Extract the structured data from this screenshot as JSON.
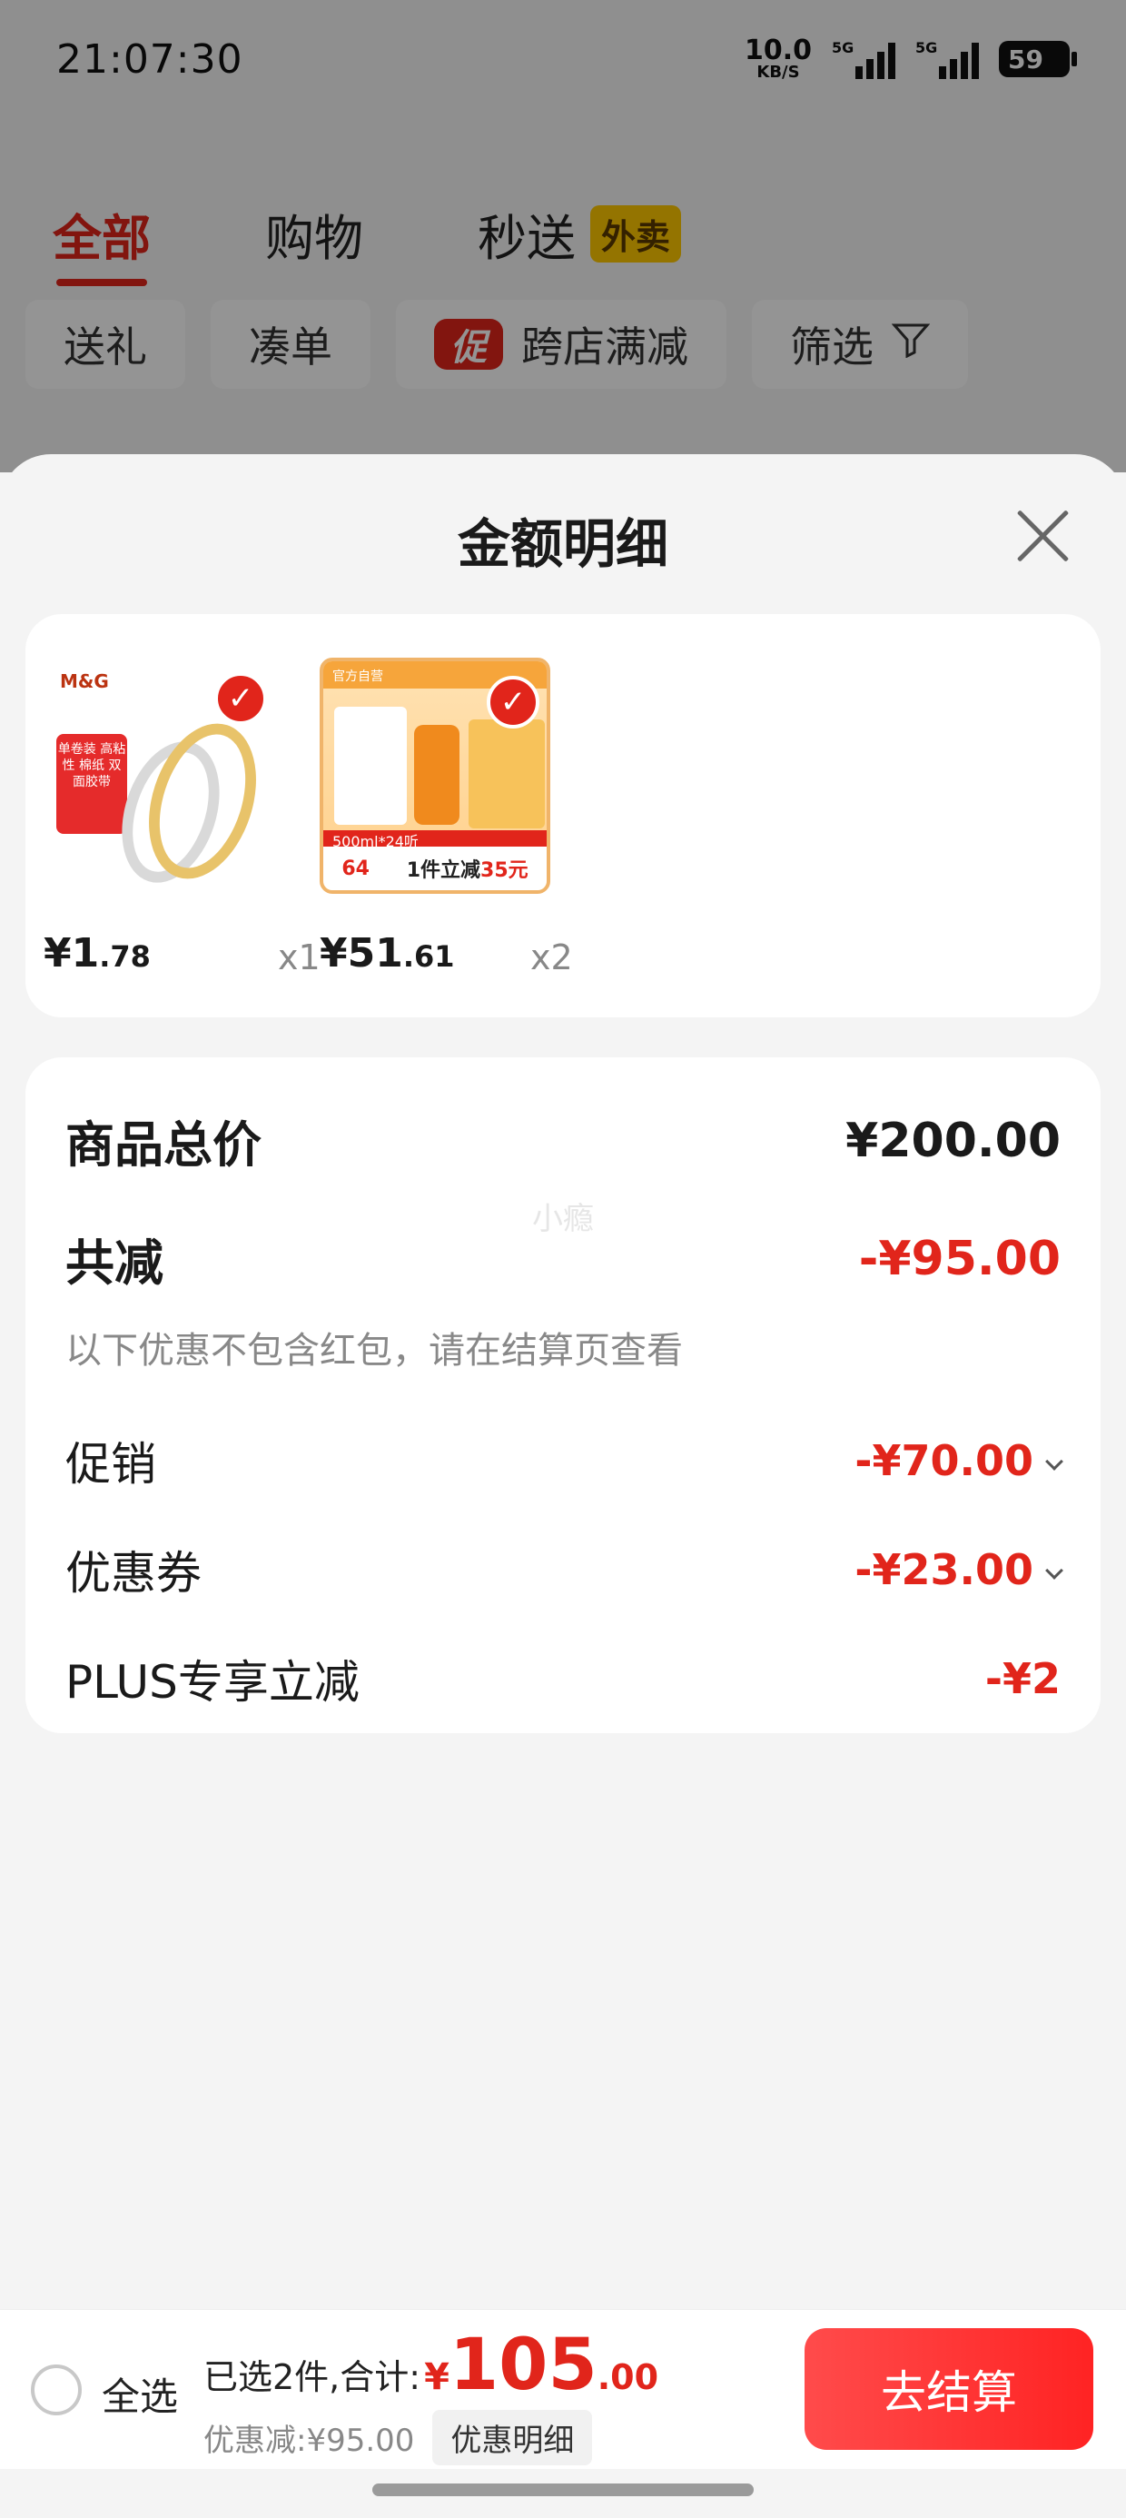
{
  "status_bar": {
    "time": "21:07:30",
    "net_speed_value": "10.0",
    "net_speed_unit": "KB/S",
    "signal_1_label": "5G",
    "signal_2_label": "5G",
    "battery": "59"
  },
  "top_tabs": [
    {
      "label": "全部",
      "active": true
    },
    {
      "label": "购物",
      "active": false
    },
    {
      "label": "秒送",
      "badge": "外卖",
      "active": false
    }
  ],
  "filter_chips": [
    {
      "label": "送礼"
    },
    {
      "label": "凑单"
    },
    {
      "label": "跨店满减",
      "promo_icon": "促"
    },
    {
      "label": "筛选"
    }
  ],
  "sheet": {
    "title": "金额明细",
    "products": [
      {
        "name": "tape",
        "brand_text": "M&G",
        "label_text": "单卷装 高粘性 棉纸 双面胶带",
        "price_main": "¥1",
        "price_decimal": ".78",
        "quantity": "x1"
      },
      {
        "name": "beer",
        "top_text": "官方自营",
        "band_text": "500ml*24听",
        "foot_price": "64",
        "foot_promo_prefix": "1件立减",
        "foot_promo_value": "35元",
        "price_main": "¥51",
        "price_decimal": ".61",
        "quantity": "x2"
      }
    ],
    "summary": {
      "total_label": "商品总价",
      "total_value": "¥200.00",
      "watermark": "小瘾",
      "reduce_label": "共减",
      "reduce_value": "-¥95.00",
      "reduce_note": "以下优惠不包含红包，请在结算页查看",
      "promo_label": "促销",
      "promo_value": "-¥70.00",
      "coupon_label": "优惠券",
      "coupon_value": "-¥23.00",
      "plus_label": "PLUS专享立减",
      "plus_value": "-¥2"
    }
  },
  "bottom_bar": {
    "select_all": "全选",
    "selected_text": "已选2件,合计:",
    "currency": "¥",
    "total_int": "105",
    "total_dec": ".00",
    "discount_text": "优惠减:¥95.00",
    "detail_button": "优惠明细",
    "checkout_button": "去结算"
  },
  "colors": {
    "accent": "#e1251b",
    "badge_yellow": "#ffc800",
    "sheet_bg": "#f4f4f4"
  }
}
